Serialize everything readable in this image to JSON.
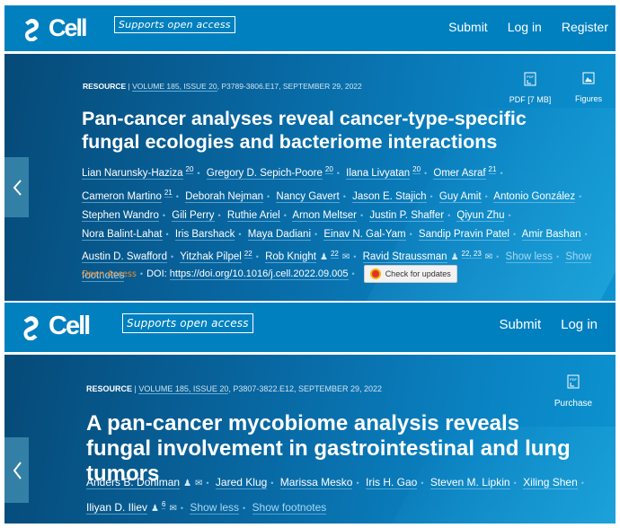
{
  "colors": {
    "header": "#0180c0",
    "open_access": "#f08a2c"
  },
  "header1": {
    "logo": "Cell",
    "badge": "Supports open access",
    "nav": [
      "Submit",
      "Log in",
      "Register"
    ]
  },
  "article1": {
    "type": "RESOURCE",
    "volume": "VOLUME 185, ISSUE 20",
    "pages": ", P3789-3806.E17, SEPTEMBER 29, 2022",
    "tools": [
      {
        "label": "PDF [7 MB]",
        "icon": "pdf-icon"
      },
      {
        "label": "Figures",
        "icon": "image-icon"
      }
    ],
    "title": "Pan-cancer analyses reveal cancer-type-specific fungal ecologies and bacteriome interactions",
    "authors": [
      {
        "name": "Lian Narunsky-Haziza",
        "sup": "20"
      },
      {
        "name": "Gregory D. Sepich-Poore",
        "sup": "20"
      },
      {
        "name": "Ilana Livyatan",
        "sup": "20"
      },
      {
        "name": "Omer Asraf",
        "sup": "21"
      },
      {
        "name": "Cameron Martino",
        "sup": "21"
      },
      {
        "name": "Deborah Nejman"
      },
      {
        "name": "Nancy Gavert"
      },
      {
        "name": "Jason E. Stajich"
      },
      {
        "name": "Guy Amit"
      },
      {
        "name": "Antonio González"
      },
      {
        "name": "Stephen Wandro"
      },
      {
        "name": "Gili Perry"
      },
      {
        "name": "Ruthie Ariel"
      },
      {
        "name": "Arnon Meltser"
      },
      {
        "name": "Justin P. Shaffer"
      },
      {
        "name": "Qiyun Zhu"
      },
      {
        "name": "Nora Balint-Lahat"
      },
      {
        "name": "Iris Barshack"
      },
      {
        "name": "Maya Dadiani"
      },
      {
        "name": "Einav N. Gal-Yam"
      },
      {
        "name": "Sandip Pravin Patel"
      },
      {
        "name": "Amir Bashan"
      },
      {
        "name": "Austin D. Swafford"
      },
      {
        "name": "Yitzhak Pilpel",
        "sup": "22"
      },
      {
        "name": "Rob Knight",
        "person": true,
        "sup": "22",
        "mail": true
      },
      {
        "name": "Ravid Straussman",
        "person": true,
        "sup": "22, 23",
        "mail": true
      }
    ],
    "show_less": "Show less",
    "show_footnotes": "Show footnotes",
    "open_access": "Open Access",
    "doi_label": "DOI:",
    "doi": "https://doi.org/10.1016/j.cell.2022.09.005",
    "check_updates": "Check for updates"
  },
  "header2": {
    "logo": "Cell",
    "badge": "Supports open access",
    "nav": [
      "Submit",
      "Log in"
    ]
  },
  "article2": {
    "type": "RESOURCE",
    "volume": "VOLUME 185, ISSUE 20",
    "pages": ", P3807-3822.E12, SEPTEMBER 29, 2022",
    "tools": [
      {
        "label": "Purchase",
        "icon": "pdf-icon"
      }
    ],
    "title": "A pan-cancer mycobiome analysis reveals fungal involvement in gastrointestinal and lung tumors",
    "authors": [
      {
        "name": "Anders B. Dohlman",
        "person": true,
        "mail": true
      },
      {
        "name": "Jared Klug"
      },
      {
        "name": "Marissa Mesko"
      },
      {
        "name": "Iris H. Gao"
      },
      {
        "name": "Steven M. Lipkin"
      },
      {
        "name": "Xiling Shen"
      },
      {
        "name": "Iliyan D. Iliev",
        "person": true,
        "sup": "6",
        "mail": true
      }
    ],
    "show_less": "Show less",
    "show_footnotes": "Show footnotes"
  }
}
